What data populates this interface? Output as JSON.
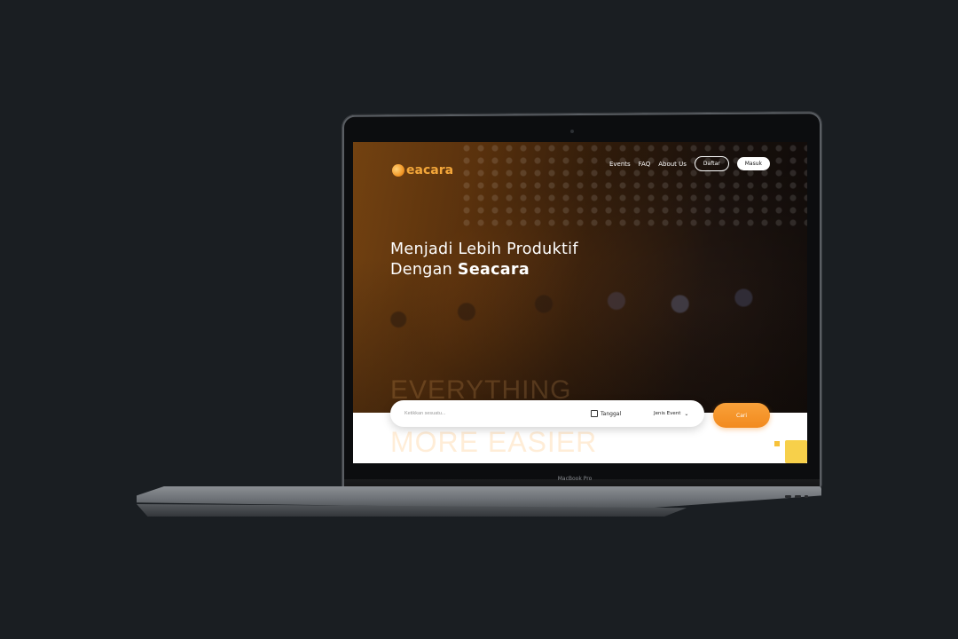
{
  "brand": {
    "name": "Seacara",
    "name_rest": "eacara"
  },
  "nav": {
    "links": [
      "Events",
      "FAQ",
      "About Us"
    ],
    "register_label": "Daftar",
    "login_label": "Masuk"
  },
  "hero": {
    "line1": "Menjadi Lebih Produktif",
    "line2_prefix": "Dengan ",
    "line2_brand": "Seacara",
    "bg_text_1": "EVERYTHING",
    "bg_text_2": "MORE EASIER"
  },
  "search": {
    "placeholder": "Ketikkan sesuatu...",
    "date_label": "Tanggal",
    "type_label": "Jenis Event",
    "button_label": "Cari"
  },
  "device": {
    "model": "MacBook Pro"
  },
  "colors": {
    "accent": "#f28a1e",
    "brand": "#f4a73a",
    "square": "#f7d04a"
  }
}
